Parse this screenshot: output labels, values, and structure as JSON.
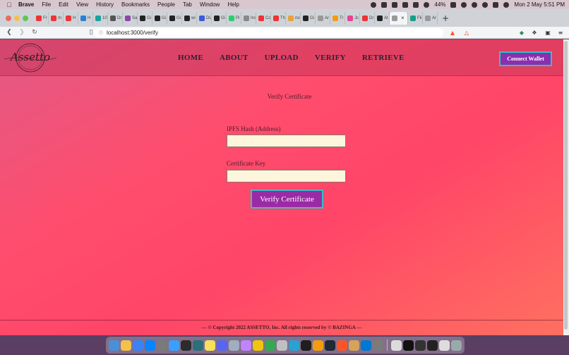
{
  "menubar": {
    "app": "Brave",
    "items": [
      "File",
      "Edit",
      "View",
      "History",
      "Bookmarks",
      "People",
      "Tab",
      "Window",
      "Help"
    ],
    "battery": "44%",
    "clock": "Mon 2 May  5:51 PM"
  },
  "tabs": [
    {
      "label": "Fr",
      "color": "#e33"
    },
    {
      "label": "m",
      "color": "#e33"
    },
    {
      "label": "H",
      "color": "#e33"
    },
    {
      "label": "H",
      "color": "#2a7fd4"
    },
    {
      "label": "10",
      "color": "#1aa1a1"
    },
    {
      "label": "Dr",
      "color": "#555"
    },
    {
      "label": "Sa",
      "color": "#8e44ad"
    },
    {
      "label": "Gi",
      "color": "#222"
    },
    {
      "label": "Gi",
      "color": "#222"
    },
    {
      "label": "Gi",
      "color": "#222"
    },
    {
      "label": "wi",
      "color": "#222"
    },
    {
      "label": "DL",
      "color": "#3b5bdb"
    },
    {
      "label": "Gi",
      "color": "#222"
    },
    {
      "label": "Pi",
      "color": "#2ecc71"
    },
    {
      "label": "Ins",
      "color": "#888"
    },
    {
      "label": "Co",
      "color": "#e33"
    },
    {
      "label": "Th",
      "color": "#e33"
    },
    {
      "label": "no",
      "color": "#e8a33b"
    },
    {
      "label": "Gi",
      "color": "#222"
    },
    {
      "label": "Ar",
      "color": "#999"
    },
    {
      "label": "Tr",
      "color": "#f39c12"
    },
    {
      "label": "Jc",
      "color": "#e84393"
    },
    {
      "label": "Dr",
      "color": "#e33"
    },
    {
      "label": "At",
      "color": "#222"
    },
    {
      "label": "",
      "color": "#999",
      "active": true
    },
    {
      "label": "Fli",
      "color": "#16a085"
    },
    {
      "label": "Ar",
      "color": "#999"
    }
  ],
  "address": {
    "url": "localhost:3000/verify"
  },
  "site": {
    "logo_text": "Assetto",
    "nav": [
      "HOME",
      "ABOUT",
      "UPLOAD",
      "VERIFY",
      "RETRIEVE"
    ],
    "connect_wallet": "Connect Wallet",
    "heading": "Verify Certificate",
    "ipfs_label": "IPFS Hash (Address)",
    "ipfs_value": "",
    "key_label": "Certificate Key",
    "key_value": "",
    "verify_button": "Verify Certificate",
    "footer": "— © Copyright 2022 ASSETTO, Inc. All rights reserved by © BAZINGA —"
  },
  "dock": {
    "apps": [
      "#4a90d9",
      "#f2c14e",
      "#3b82f6",
      "#0a84ff",
      "#7a7a7a",
      "#3aa0ff",
      "#2c2c2c",
      "#2b6f7a",
      "#f6e05e",
      "#5865f2",
      "#a0aec0",
      "#c084fc",
      "#f1c40f",
      "#34a853",
      "#c0c0c0",
      "#2aa1d3",
      "#1e1e1e",
      "#f39c12",
      "#1f2937",
      "#fb542b",
      "#d4a45a",
      "#0078d4",
      "#7b7b7b"
    ],
    "recent": [
      "#dcdcdc",
      "#111",
      "#333",
      "#222",
      "#ddd",
      "#9aa"
    ]
  }
}
